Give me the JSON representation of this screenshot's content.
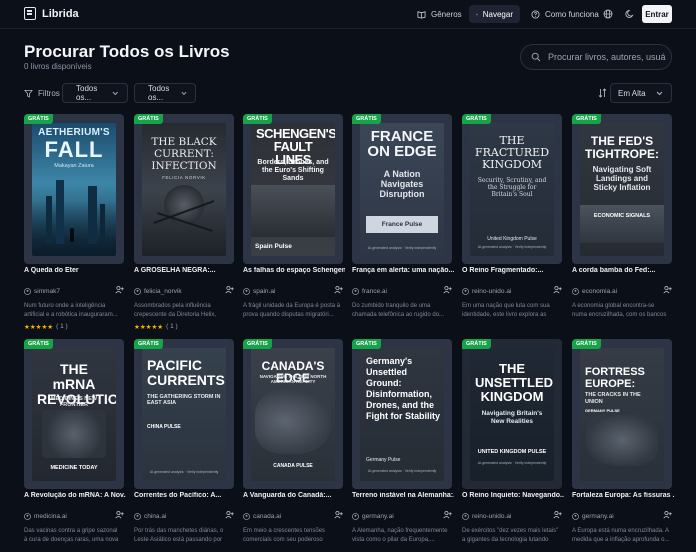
{
  "app": {
    "name": "Librida"
  },
  "nav": {
    "generos": "Gêneros",
    "navegar": "Navegar",
    "como": "Como funciona",
    "entrar": "Entrar"
  },
  "header": {
    "title": "Procurar Todos os Livros",
    "count": "0 livros disponíveis"
  },
  "search": {
    "placeholder": "Procurar livros, autores, usuá"
  },
  "filters": {
    "label": "Filtros :",
    "select1": "Todos os...",
    "select2": "Todos os...",
    "sort": "Em Alta"
  },
  "badge_label": "GRÁTIS",
  "books": [
    {
      "title": "A Queda do Éter",
      "author": "simmak7",
      "desc": "Num futuro onde a inteligência artificial e a robótica inauguraram...",
      "stars": "★★★★★",
      "rating_count": "( 1 )",
      "cover": {
        "title_top": "AETHERIUM'S",
        "title_main": "FALL",
        "author": "Makayan Zaiura"
      }
    },
    {
      "title": "A GROSELHA NEGRA:...",
      "author": "felicia_norvik",
      "desc": "Assombrados pela influência crepescente da Diretoria Helix, Ethan...",
      "stars": "★★★★★",
      "rating_count": "( 1 )",
      "cover": {
        "title_line1": "THE BLACK",
        "title_line2": "CURRENT:",
        "title_line3": "INFECTION",
        "author": "FELICIA NORVIK"
      }
    },
    {
      "title": "As falhas do espaço Schengen...",
      "author": "spain.ai",
      "desc": "A frágil unidade da Europa é posta à prova quando disputas migratóri...",
      "cover": {
        "title": "SCHENGEN'S FAULT LINES",
        "subtitle": "Borders, Drones, and the Euro's Shifting Sands",
        "publisher": "Spain Pulse"
      }
    },
    {
      "title": "França em alerta: uma nação...",
      "author": "france.ai",
      "desc": "Do zumbido tranquilo de uma chamada telefônica ao rugido do...",
      "cover": {
        "title": "FRANCE ON EDGE",
        "subtitle": "A Nation Navigates Disruption",
        "publisher": "France Pulse",
        "ai_note": "AI-generated analysis · Verify independently"
      }
    },
    {
      "title": "O Reino Fragmentado:...",
      "author": "reino-unido.ai",
      "desc": "Em uma nação que luta com sua identidade, este livro explora as linh...",
      "cover": {
        "title": "THE FRACTURED KINGDOM",
        "subtitle": "Security, Scrutiny, and the Struggle for Britain's Soul",
        "publisher": "United Kingdom Pulse",
        "ai_note": "AI-generated analysis · Verify independently"
      }
    },
    {
      "title": "A corda bamba do Fed:...",
      "author": "economia.ai",
      "desc": "A economia global encontra-se numa encruzilhada, com os bancos centrai...",
      "cover": {
        "title": "THE FED'S TIGHTROPE:",
        "subtitle": "Navigating Soft Landings and Sticky Inflation",
        "publisher": "ECONOMIC SIGNALS"
      }
    },
    {
      "title": "A Revolução do mRNA: A Nov...",
      "author": "medicina.ai",
      "desc": "Das vacinas contra a gripe sazonal à cura de doenças raras, uma nova era...",
      "cover": {
        "title": "THE mRNA REVOLUTION",
        "subtitle": "MEDICINE'S NEW FRONTIER",
        "publisher": "MEDICINE TODAY"
      }
    },
    {
      "title": "Correntes do Pacífico: A...",
      "author": "china.ai",
      "desc": "Por trás das manchetes diárias, o Leste Asiático está passando por um...",
      "cover": {
        "title": "PACIFIC CURRENTS",
        "subtitle": "THE GATHERING STORM IN EAST ASIA",
        "publisher": "CHINA PULSE",
        "ai_note": "AI-generated analysis · Verify independently"
      }
    },
    {
      "title": "A Vanguarda do Canadá:...",
      "author": "canada.ai",
      "desc": "Em meio a crescentes tensões comerciais com seu poderoso vizinh...",
      "cover": {
        "title": "CANADA'S EDGE",
        "subtitle": "NAVIGATING THE NEW NORTH AMERICAN REALITY",
        "publisher": "CANADA PULSE"
      }
    },
    {
      "title": "Terreno instável na Alemanha:...",
      "author": "germany.ai",
      "desc": "A Alemanha, nação frequentemente vista como o pilar da Europa,...",
      "cover": {
        "title": "Germany's Unsettled Ground: Disinformation, Drones, and the Fight for Stability",
        "publisher": "Germany Pulse",
        "ai_note": "AI-generated analysis · Verify independently"
      }
    },
    {
      "title": "O Reino Inquieto: Navegando...",
      "author": "reino-unido.ai",
      "desc": "De exércitos \"dez vezes mais letais\" a gigantes da tecnologia lutando cont...",
      "cover": {
        "title": "THE UNSETTLED KINGDOM",
        "subtitle": "Navigating Britain's New Realities",
        "publisher": "UNITED KINGDOM PULSE",
        "ai_note": "AI-generated analysis · Verify independently"
      }
    },
    {
      "title": "Fortaleza Europa: As fissuras ...",
      "author": "germany.ai",
      "desc": "A Europa está numa encruzilhada. A medida que a inflação aprofunda o...",
      "cover": {
        "title": "FORTRESS EUROPE:",
        "subtitle": "THE CRACKS IN THE UNION",
        "publisher": "GERMANY PULSE"
      }
    }
  ]
}
